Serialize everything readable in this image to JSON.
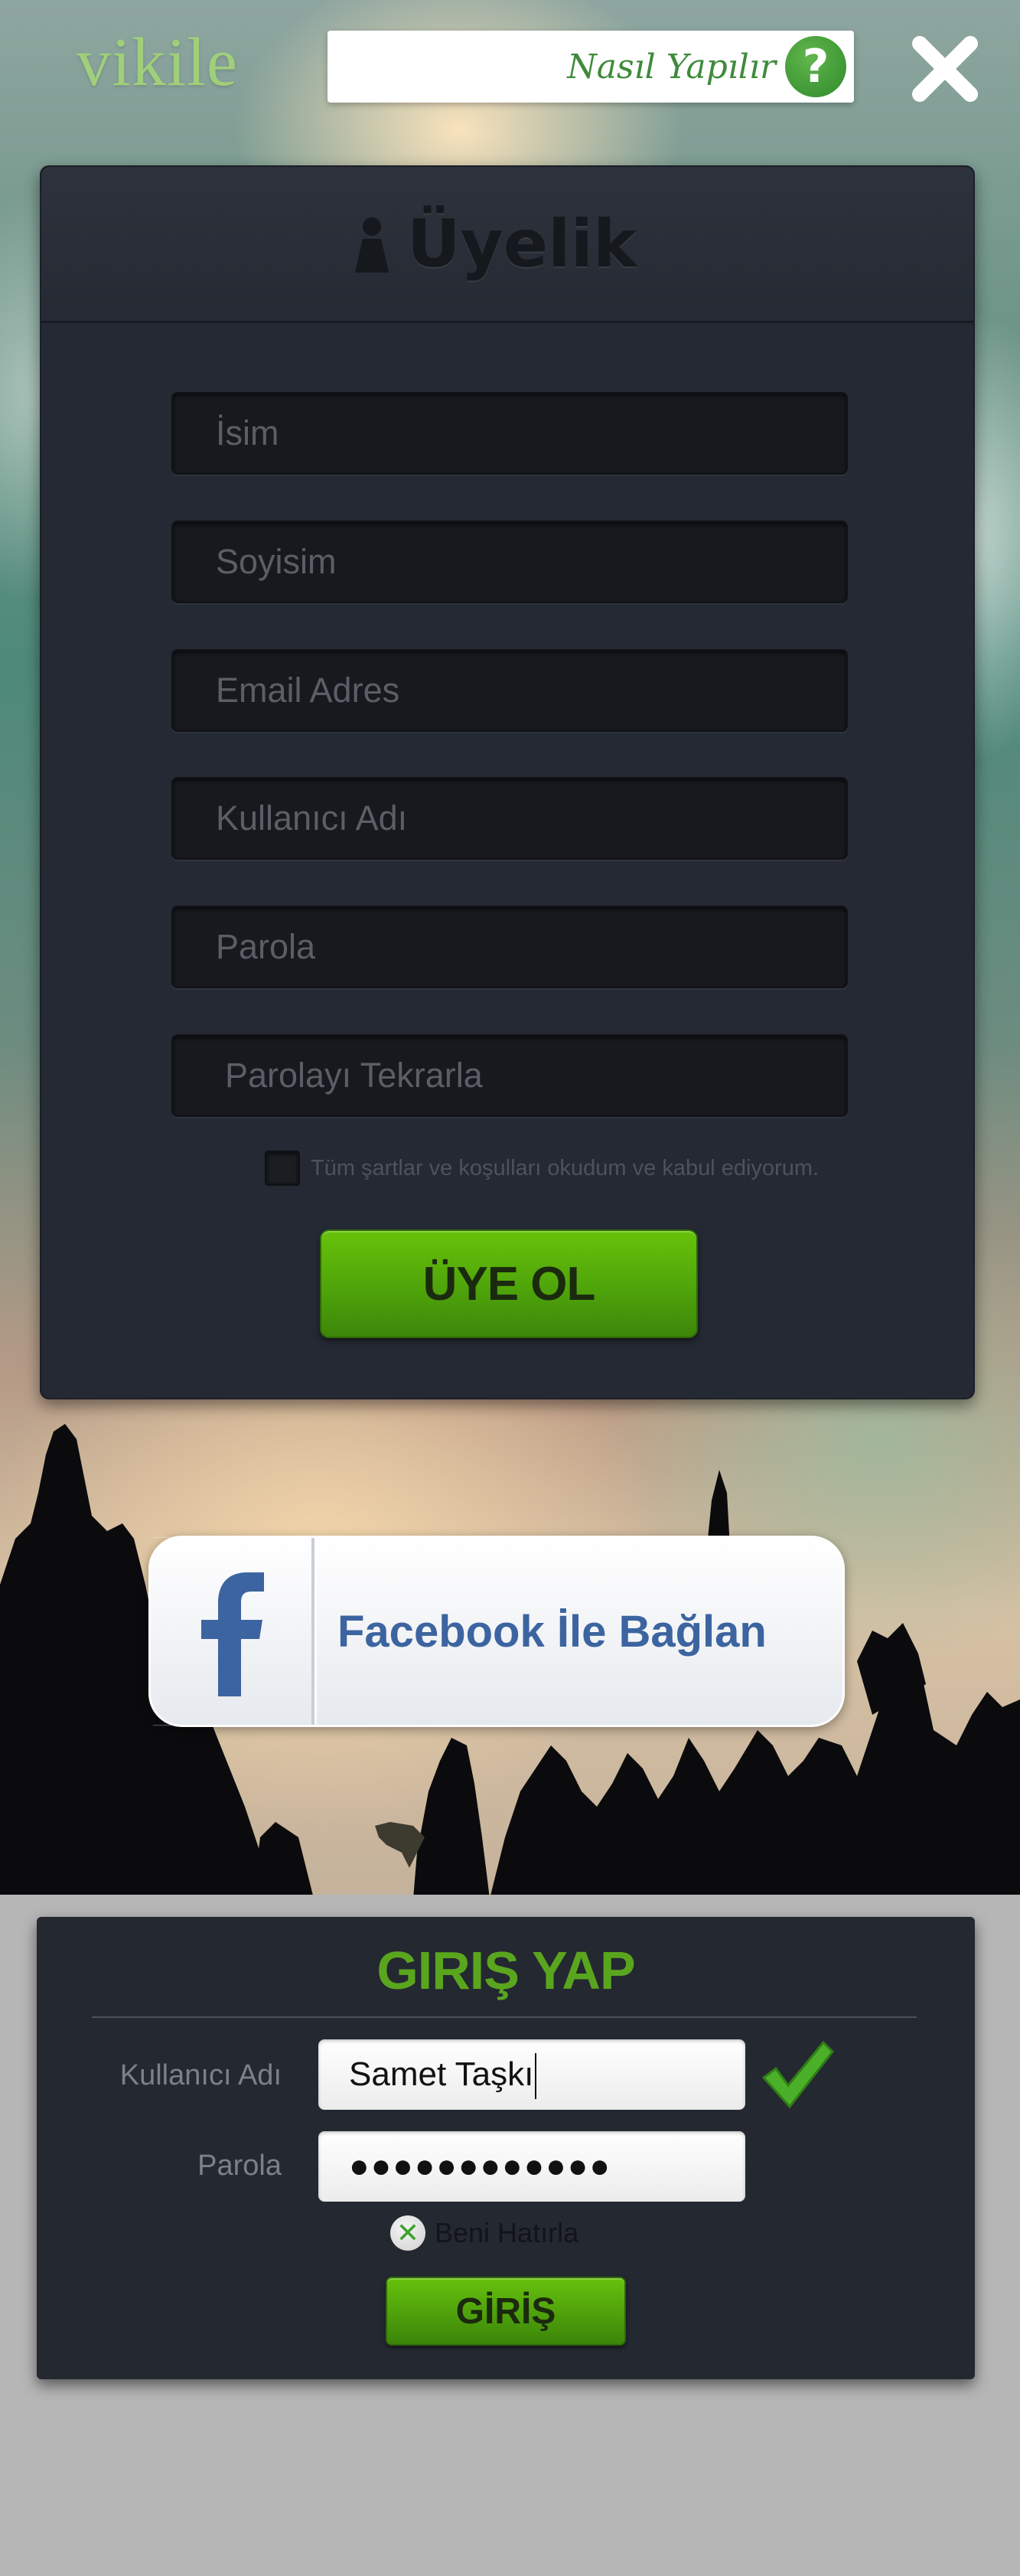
{
  "header": {
    "logo": "vikile",
    "help_text": "Nasıl Yapılır",
    "help_icon": "question-icon",
    "close_icon": "close-icon"
  },
  "register": {
    "title": "Üyelik",
    "title_icon": "user-icon",
    "fields": {
      "name": "İsim",
      "surname": "Soyisim",
      "email": "Email Adres",
      "username": "Kullanıcı Adı",
      "password": "Parola",
      "password_repeat": "Parolayı Tekrarla"
    },
    "terms_text": "Tüm şartlar ve koşulları okudum ve kabul ediyorum.",
    "terms_checked": false,
    "submit_label": "ÜYE OL"
  },
  "facebook": {
    "label": "Facebook İle Bağlan",
    "icon": "facebook-icon"
  },
  "login": {
    "title": "GIRIŞ YAP",
    "username_label": "Kullanıcı Adı",
    "username_value": "Samet Taşkı",
    "password_label": "Parola",
    "password_value": "●●●●●●●●●●●●",
    "username_valid_icon": "checkmark-icon",
    "remember_label": "Beni Hatırla",
    "remember_checked": true,
    "submit_label": "GİRİŞ"
  },
  "colors": {
    "accent_green": "#5aa51e",
    "button_green": "#4fa40a",
    "panel_dark": "#242933",
    "facebook_blue": "#3c64a0"
  }
}
